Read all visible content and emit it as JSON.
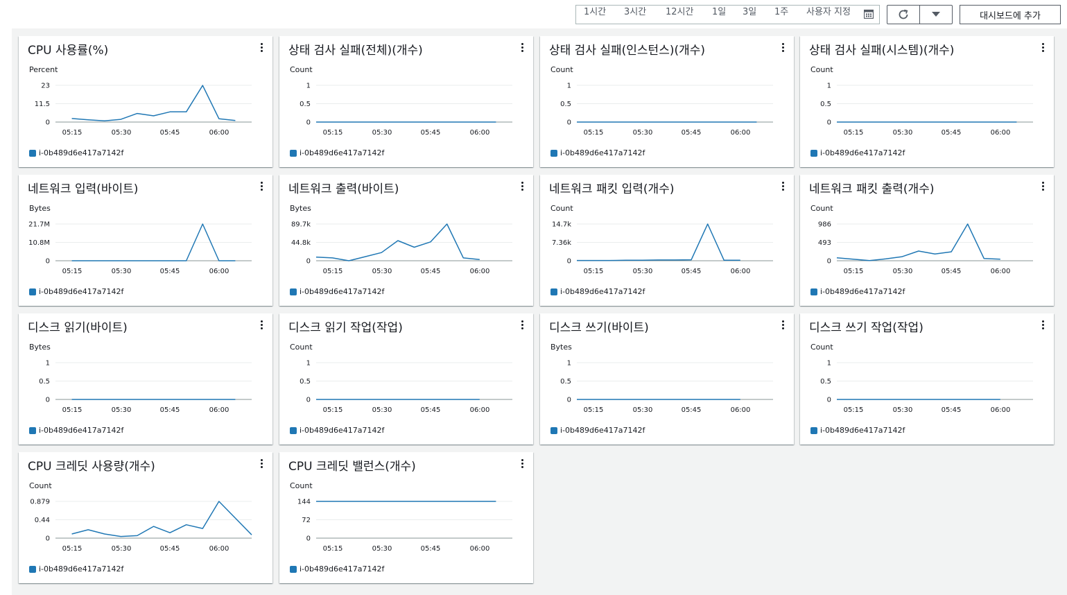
{
  "toolbar": {
    "ranges": [
      "1시간",
      "3시간",
      "12시간",
      "1일",
      "3일",
      "1주",
      "사용자 지정"
    ],
    "add_to_dashboard": "대시보드에 추가"
  },
  "series_color": "#1f77b4",
  "widgets": [
    {
      "title": "CPU 사용률(%)",
      "unit": "Percent",
      "legend": "i-0b489d6e417a7142f",
      "chart_data": {
        "type": "line",
        "ylim": [
          0,
          23
        ],
        "yticks": [
          "0",
          "11.5",
          "23"
        ],
        "xticks": [
          "05:15",
          "05:30",
          "05:45",
          "06:00"
        ],
        "series": [
          {
            "name": "i-0b489d6e417a7142f",
            "points": [
              [
                5,
                2.2
              ],
              [
                10,
                1.4
              ],
              [
                15,
                0.8
              ],
              [
                20,
                1.7
              ],
              [
                25,
                5.4
              ],
              [
                30,
                3.9
              ],
              [
                35,
                6.4
              ],
              [
                40,
                6.4
              ],
              [
                45,
                22.9
              ],
              [
                50,
                2.1
              ],
              [
                55,
                1.0
              ]
            ]
          }
        ]
      }
    },
    {
      "title": "상태 검사 실패(전체)(개수)",
      "unit": "Count",
      "legend": "i-0b489d6e417a7142f",
      "chart_data": {
        "type": "line",
        "ylim": [
          0,
          1
        ],
        "yticks": [
          "0",
          "0.5",
          "1"
        ],
        "xticks": [
          "05:15",
          "05:30",
          "05:45",
          "06:00"
        ],
        "series": [
          {
            "name": "i-0b489d6e417a7142f",
            "points": [
              [
                0,
                0
              ],
              [
                55,
                0
              ]
            ]
          }
        ]
      }
    },
    {
      "title": "상태 검사 실패(인스턴스)(개수)",
      "unit": "Count",
      "legend": "i-0b489d6e417a7142f",
      "chart_data": {
        "type": "line",
        "ylim": [
          0,
          1
        ],
        "yticks": [
          "0",
          "0.5",
          "1"
        ],
        "xticks": [
          "05:15",
          "05:30",
          "05:45",
          "06:00"
        ],
        "series": [
          {
            "name": "i-0b489d6e417a7142f",
            "points": [
              [
                0,
                0
              ],
              [
                55,
                0
              ]
            ]
          }
        ]
      }
    },
    {
      "title": "상태 검사 실패(시스템)(개수)",
      "unit": "Count",
      "legend": "i-0b489d6e417a7142f",
      "chart_data": {
        "type": "line",
        "ylim": [
          0,
          1
        ],
        "yticks": [
          "0",
          "0.5",
          "1"
        ],
        "xticks": [
          "05:15",
          "05:30",
          "05:45",
          "06:00"
        ],
        "series": [
          {
            "name": "i-0b489d6e417a7142f",
            "points": [
              [
                0,
                0
              ],
              [
                55,
                0
              ]
            ]
          }
        ]
      }
    },
    {
      "title": "네트워크 입력(바이트)",
      "unit": "Bytes",
      "legend": "i-0b489d6e417a7142f",
      "chart_data": {
        "type": "line",
        "ylim": [
          0,
          21.7
        ],
        "yticks": [
          "0",
          "10.8M",
          "21.7M"
        ],
        "xticks": [
          "05:15",
          "05:30",
          "05:45",
          "06:00"
        ],
        "series": [
          {
            "name": "i-0b489d6e417a7142f",
            "points": [
              [
                5,
                0
              ],
              [
                10,
                0
              ],
              [
                15,
                0
              ],
              [
                20,
                0
              ],
              [
                25,
                0
              ],
              [
                30,
                0
              ],
              [
                35,
                0
              ],
              [
                40,
                0
              ],
              [
                45,
                21.7
              ],
              [
                50,
                0
              ],
              [
                55,
                0
              ]
            ]
          }
        ]
      }
    },
    {
      "title": "네트워크 출력(바이트)",
      "unit": "Bytes",
      "legend": "i-0b489d6e417a7142f",
      "chart_data": {
        "type": "line",
        "ylim": [
          0,
          89.7
        ],
        "yticks": [
          "0",
          "44.8k",
          "89.7k"
        ],
        "xticks": [
          "05:15",
          "05:30",
          "05:45",
          "06:00"
        ],
        "series": [
          {
            "name": "i-0b489d6e417a7142f",
            "points": [
              [
                0,
                9
              ],
              [
                5,
                7
              ],
              [
                10,
                0
              ],
              [
                15,
                10
              ],
              [
                20,
                20
              ],
              [
                25,
                49
              ],
              [
                30,
                33
              ],
              [
                35,
                46
              ],
              [
                40,
                89.7
              ],
              [
                45,
                7
              ],
              [
                50,
                3
              ]
            ]
          }
        ]
      }
    },
    {
      "title": "네트워크 패킷 입력(개수)",
      "unit": "Count",
      "legend": "i-0b489d6e417a7142f",
      "chart_data": {
        "type": "line",
        "ylim": [
          0,
          14.7
        ],
        "yticks": [
          "0",
          "7.36k",
          "14.7k"
        ],
        "xticks": [
          "05:15",
          "05:30",
          "05:45",
          "06:00"
        ],
        "series": [
          {
            "name": "i-0b489d6e417a7142f",
            "points": [
              [
                0,
                0.1
              ],
              [
                5,
                0.1
              ],
              [
                10,
                0.1
              ],
              [
                15,
                0.2
              ],
              [
                20,
                0.2
              ],
              [
                25,
                0.3
              ],
              [
                30,
                0.3
              ],
              [
                35,
                0.4
              ],
              [
                40,
                14.7
              ],
              [
                45,
                0.2
              ],
              [
                50,
                0.2
              ]
            ]
          }
        ]
      }
    },
    {
      "title": "네트워크 패킷 출력(개수)",
      "unit": "Count",
      "legend": "i-0b489d6e417a7142f",
      "chart_data": {
        "type": "line",
        "ylim": [
          0,
          986
        ],
        "yticks": [
          "0",
          "493",
          "986"
        ],
        "xticks": [
          "05:15",
          "05:30",
          "05:45",
          "06:00"
        ],
        "series": [
          {
            "name": "i-0b489d6e417a7142f",
            "points": [
              [
                0,
                80
              ],
              [
                5,
                40
              ],
              [
                10,
                5
              ],
              [
                15,
                50
              ],
              [
                20,
                110
              ],
              [
                25,
                260
              ],
              [
                30,
                180
              ],
              [
                35,
                240
              ],
              [
                40,
                986
              ],
              [
                45,
                60
              ],
              [
                50,
                40
              ]
            ]
          }
        ]
      }
    },
    {
      "title": "디스크 읽기(바이트)",
      "unit": "Bytes",
      "legend": "i-0b489d6e417a7142f",
      "chart_data": {
        "type": "line",
        "ylim": [
          0,
          1
        ],
        "yticks": [
          "0",
          "0.5",
          "1"
        ],
        "xticks": [
          "05:15",
          "05:30",
          "05:45",
          "06:00"
        ],
        "series": [
          {
            "name": "i-0b489d6e417a7142f",
            "points": [
              [
                5,
                0
              ],
              [
                55,
                0
              ]
            ]
          }
        ]
      }
    },
    {
      "title": "디스크 읽기 작업(작업)",
      "unit": "Count",
      "legend": "i-0b489d6e417a7142f",
      "chart_data": {
        "type": "line",
        "ylim": [
          0,
          1
        ],
        "yticks": [
          "0",
          "0.5",
          "1"
        ],
        "xticks": [
          "05:15",
          "05:30",
          "05:45",
          "06:00"
        ],
        "series": [
          {
            "name": "i-0b489d6e417a7142f",
            "points": [
              [
                0,
                0
              ],
              [
                50,
                0
              ]
            ]
          }
        ]
      }
    },
    {
      "title": "디스크 쓰기(바이트)",
      "unit": "Bytes",
      "legend": "i-0b489d6e417a7142f",
      "chart_data": {
        "type": "line",
        "ylim": [
          0,
          1
        ],
        "yticks": [
          "0",
          "0.5",
          "1"
        ],
        "xticks": [
          "05:15",
          "05:30",
          "05:45",
          "06:00"
        ],
        "series": [
          {
            "name": "i-0b489d6e417a7142f",
            "points": [
              [
                0,
                0
              ],
              [
                50,
                0
              ]
            ]
          }
        ]
      }
    },
    {
      "title": "디스크 쓰기 작업(작업)",
      "unit": "Count",
      "legend": "i-0b489d6e417a7142f",
      "chart_data": {
        "type": "line",
        "ylim": [
          0,
          1
        ],
        "yticks": [
          "0",
          "0.5",
          "1"
        ],
        "xticks": [
          "05:15",
          "05:30",
          "05:45",
          "06:00"
        ],
        "series": [
          {
            "name": "i-0b489d6e417a7142f",
            "points": [
              [
                0,
                0
              ],
              [
                50,
                0
              ]
            ]
          }
        ]
      }
    },
    {
      "title": "CPU 크레딧 사용량(개수)",
      "unit": "Count",
      "legend": "i-0b489d6e417a7142f",
      "chart_data": {
        "type": "line",
        "ylim": [
          0,
          0.879
        ],
        "yticks": [
          "0",
          "0.44",
          "0.879"
        ],
        "xticks": [
          "05:15",
          "05:30",
          "05:45",
          "06:00"
        ],
        "series": [
          {
            "name": "i-0b489d6e417a7142f",
            "points": [
              [
                5,
                0.1
              ],
              [
                10,
                0.2
              ],
              [
                15,
                0.1
              ],
              [
                20,
                0.04
              ],
              [
                25,
                0.06
              ],
              [
                30,
                0.28
              ],
              [
                35,
                0.13
              ],
              [
                40,
                0.32
              ],
              [
                45,
                0.23
              ],
              [
                50,
                0.879
              ],
              [
                60,
                0.08
              ]
            ]
          }
        ]
      }
    },
    {
      "title": "CPU 크레딧 밸런스(개수)",
      "unit": "Count",
      "legend": "i-0b489d6e417a7142f",
      "chart_data": {
        "type": "line",
        "ylim": [
          0,
          144
        ],
        "yticks": [
          "0",
          "72",
          "144"
        ],
        "xticks": [
          "05:15",
          "05:30",
          "05:45",
          "06:00"
        ],
        "series": [
          {
            "name": "i-0b489d6e417a7142f",
            "points": [
              [
                0,
                144
              ],
              [
                55,
                144
              ]
            ]
          }
        ]
      }
    }
  ]
}
